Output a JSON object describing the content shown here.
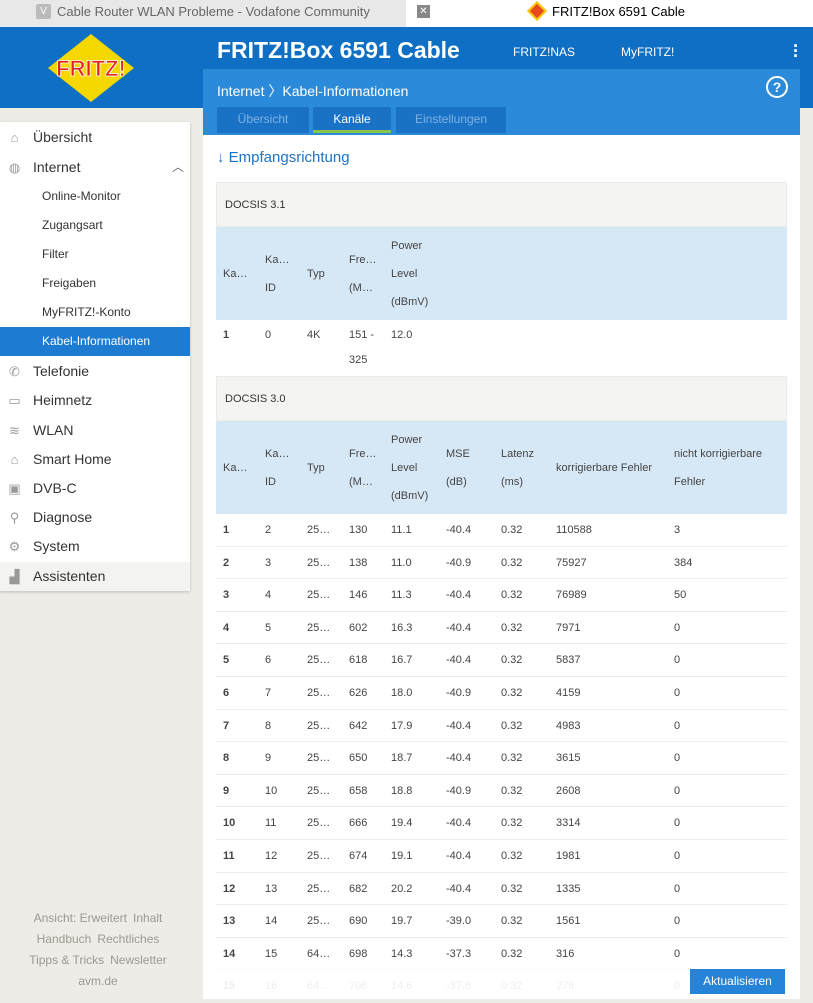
{
  "browser": {
    "tab1": "Cable Router WLAN Probleme - Vodafone Community",
    "tab1_favicon": "V",
    "tab2": "FRITZ!Box 6591 Cable"
  },
  "header": {
    "logo": "FRITZ!",
    "title": "FRITZ!Box 6591 Cable",
    "links": [
      "FRITZ!NAS",
      "MyFRITZ!"
    ]
  },
  "breadcrumb": "Internet 〉Kabel-Informationen",
  "tabs": [
    "Übersicht",
    "Kanäle",
    "Einstellungen"
  ],
  "sidebar": [
    {
      "label": "Übersicht",
      "icon": "⌂"
    },
    {
      "label": "Internet",
      "icon": "◍"
    },
    {
      "label": "Online-Monitor",
      "sub": true
    },
    {
      "label": "Zugangsart",
      "sub": true
    },
    {
      "label": "Filter",
      "sub": true
    },
    {
      "label": "Freigaben",
      "sub": true
    },
    {
      "label": "MyFRITZ!-Konto",
      "sub": true
    },
    {
      "label": "Kabel-Informationen",
      "sub": true
    },
    {
      "label": "Telefonie",
      "icon": "✆"
    },
    {
      "label": "Heimnetz",
      "icon": "▭"
    },
    {
      "label": "WLAN",
      "icon": "≋"
    },
    {
      "label": "Smart Home",
      "icon": "⌂"
    },
    {
      "label": "DVB-C",
      "icon": "▣"
    },
    {
      "label": "Diagnose",
      "icon": "⚲"
    },
    {
      "label": "System",
      "icon": "⚙"
    },
    {
      "label": "Assistenten",
      "icon": "▟"
    }
  ],
  "footer_links": [
    [
      "Ansicht: Erweitert",
      "Inhalt"
    ],
    [
      "Handbuch",
      "Rechtliches"
    ],
    [
      "Tipps & Tricks",
      "Newsletter"
    ],
    [
      "avm.de"
    ]
  ],
  "section_title": "↓ Empfangsrichtung",
  "docsis31": {
    "title": "DOCSIS 3.1",
    "headers": [
      [
        "Ka…"
      ],
      [
        "Ka…",
        "ID"
      ],
      [
        "Typ"
      ],
      [
        "Fre…",
        "(M…"
      ],
      [
        "Power",
        "Level",
        "(dBmV)"
      ]
    ],
    "rows": [
      [
        "1",
        "0",
        "4K",
        "151 -\n325",
        "12.0"
      ]
    ]
  },
  "docsis30": {
    "title": "DOCSIS 3.0",
    "headers": [
      [
        "Ka…"
      ],
      [
        "Ka…",
        "ID"
      ],
      [
        "Typ"
      ],
      [
        "Fre…",
        "(M…"
      ],
      [
        "Power",
        "Level",
        "(dBmV)"
      ],
      [
        "MSE",
        "(dB)"
      ],
      [
        "Latenz",
        "(ms)"
      ],
      [
        "korrigierbare Fehler"
      ],
      [
        "nicht korrigierbare",
        "Fehler"
      ]
    ],
    "rows": [
      [
        "1",
        "2",
        "25…",
        "130",
        "11.1",
        "-40.4",
        "0.32",
        "110588",
        "3"
      ],
      [
        "2",
        "3",
        "25…",
        "138",
        "11.0",
        "-40.9",
        "0.32",
        "75927",
        "384"
      ],
      [
        "3",
        "4",
        "25…",
        "146",
        "11.3",
        "-40.4",
        "0.32",
        "76989",
        "50"
      ],
      [
        "4",
        "5",
        "25…",
        "602",
        "16.3",
        "-40.4",
        "0.32",
        "7971",
        "0"
      ],
      [
        "5",
        "6",
        "25…",
        "618",
        "16.7",
        "-40.4",
        "0.32",
        "5837",
        "0"
      ],
      [
        "6",
        "7",
        "25…",
        "626",
        "18.0",
        "-40.9",
        "0.32",
        "4159",
        "0"
      ],
      [
        "7",
        "8",
        "25…",
        "642",
        "17.9",
        "-40.4",
        "0.32",
        "4983",
        "0"
      ],
      [
        "8",
        "9",
        "25…",
        "650",
        "18.7",
        "-40.4",
        "0.32",
        "3615",
        "0"
      ],
      [
        "9",
        "10",
        "25…",
        "658",
        "18.8",
        "-40.9",
        "0.32",
        "2608",
        "0"
      ],
      [
        "10",
        "11",
        "25…",
        "666",
        "19.4",
        "-40.4",
        "0.32",
        "3314",
        "0"
      ],
      [
        "11",
        "12",
        "25…",
        "674",
        "19.1",
        "-40.4",
        "0.32",
        "1981",
        "0"
      ],
      [
        "12",
        "13",
        "25…",
        "682",
        "20.2",
        "-40.4",
        "0.32",
        "1335",
        "0"
      ],
      [
        "13",
        "14",
        "25…",
        "690",
        "19.7",
        "-39.0",
        "0.32",
        "1561",
        "0"
      ],
      [
        "14",
        "15",
        "64…",
        "698",
        "14.3",
        "-37.3",
        "0.32",
        "316",
        "0"
      ],
      [
        "15",
        "16",
        "64…",
        "706",
        "14.6",
        "-37.6",
        "0.32",
        "276",
        "0"
      ]
    ]
  },
  "refresh_button": "Aktualisieren"
}
